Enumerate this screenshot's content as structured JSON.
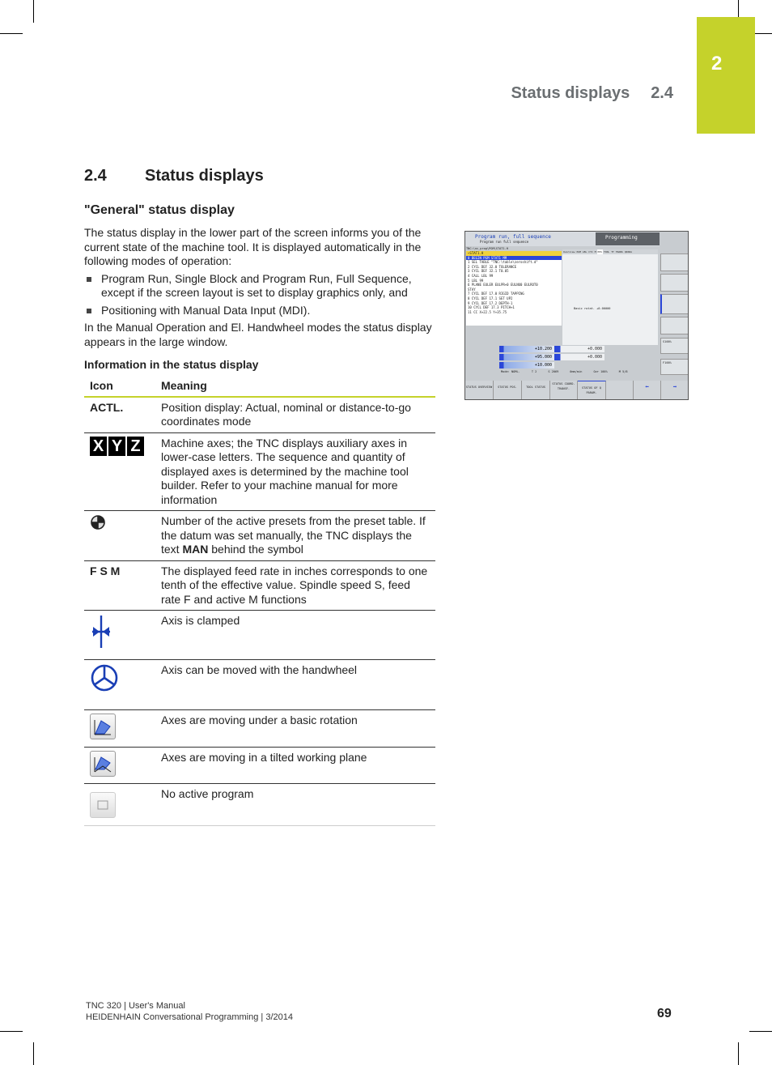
{
  "chapter_tab": "2",
  "running_header": {
    "title": "Status displays",
    "number": "2.4"
  },
  "section": {
    "number": "2.4",
    "title": "Status displays"
  },
  "subsection": "\"General\" status display",
  "intro": "The status display in the lower part of the screen informs you of the current state of the machine tool. It is displayed automatically in the following modes of operation:",
  "bullets": [
    "Program Run, Single Block and Program Run, Full Sequence, except if the screen layout is set to display graphics only, and",
    "Positioning with Manual Data Input (MDI)."
  ],
  "after_bullets": "In the Manual Operation and El. Handwheel modes the status display appears in the large window.",
  "table_title": "Information in the status display",
  "table": {
    "headers": [
      "Icon",
      "Meaning"
    ],
    "rows": [
      {
        "icon_text": "ACTL.",
        "meaning": "Position display: Actual, nominal or distance-to-go coordinates mode"
      },
      {
        "icon": "xyz-axes-icon",
        "icon_letters": [
          "X",
          "Y",
          "Z"
        ],
        "meaning": "Machine axes; the TNC displays auxiliary axes in lower-case letters. The sequence and quantity of displayed axes is determined by the machine tool builder. Refer to your machine manual for more information"
      },
      {
        "icon": "preset-datum-icon",
        "meaning_pre": "Number of the active presets from the preset table. If the datum was set manually, the TNC displays the text ",
        "meaning_bold": "MAN",
        "meaning_post": " behind the symbol"
      },
      {
        "icon_text": "F S M",
        "meaning": "The displayed feed rate in inches corresponds to one tenth of the effective value. Spindle speed S, feed rate F and active M functions"
      },
      {
        "icon": "axis-clamped-icon",
        "meaning": "Axis is clamped"
      },
      {
        "icon": "handwheel-icon",
        "meaning": "Axis can be moved with the handwheel"
      },
      {
        "icon": "basic-rotation-icon",
        "meaning": "Axes are moving under a basic rotation"
      },
      {
        "icon": "tilted-plane-icon",
        "meaning": "Axes are moving in a tilted working plane"
      },
      {
        "icon": "no-active-program-icon",
        "meaning": "No active program"
      }
    ]
  },
  "screen": {
    "mode": "Program run, full sequence",
    "submode": "Program run full sequence",
    "programming": "Programming",
    "path": "TNC:\\nc_prog\\PGM\\STAT1.H",
    "program_lines": [
      "→STAT1.H",
      "0  BEGIN PGM STAT1 MM",
      "1  SEL TABLE \"TNC:\\table\\zeroshift.d\"",
      "2  CYCL DEF 32.0 TOLERANCE",
      "3  CYCL DEF 32.1 T0.05",
      "4  CALL LBL 99",
      "5  LBL 99",
      "6  PLANE EULER EULPR+0 EULNU0 EULROT0",
      "   STAY",
      "7  CYCL DEF 17.0 RIGID TAPPING",
      "8  CYCL DEF 17.1 SET UP2",
      "9  CYCL DEF 17.2 DEPTH-1",
      "10 CYCL DEF 17.3 PITCH+1",
      "11 CC  X+22.5  Y+35.75"
    ],
    "tabs": [
      "Overview",
      "PGM",
      "LBL",
      "CYC",
      "M",
      "POS",
      "TOOL",
      "TT",
      "TRANS",
      "QPARA"
    ],
    "axes": [
      {
        "axis": "X",
        "value": "+10.200"
      },
      {
        "axis": "Y",
        "value": "+95.000"
      },
      {
        "axis": "Z",
        "value": "+10.000"
      }
    ],
    "aux_axes": [
      {
        "axis": "B",
        "value": "+0.000"
      },
      {
        "axis": "C",
        "value": "+0.000"
      }
    ],
    "basic_rotation_label": "Basic rotat.",
    "basic_rotation_value": "+0.00000",
    "status_bar": [
      "Mode: NOML.",
      "T 2",
      "S 2069",
      "0mm/min",
      "Ovr 100%",
      "M 5/8"
    ],
    "override": [
      "S100%",
      "F100%"
    ],
    "softkeys": [
      "STATUS OVERVIEW",
      "STATUS POS.",
      "TOOL STATUS",
      "STATUS COORD. TRANSF.",
      "STATUS OF Q PARAM."
    ]
  },
  "footer": {
    "line1": "TNC 320 | User's Manual",
    "line2": "HEIDENHAIN Conversational Programming | 3/2014",
    "page": "69"
  },
  "colors": {
    "accent": "#c5d22b",
    "header_gray": "#6b6f72",
    "tnc_blue": "#2b47d8"
  }
}
